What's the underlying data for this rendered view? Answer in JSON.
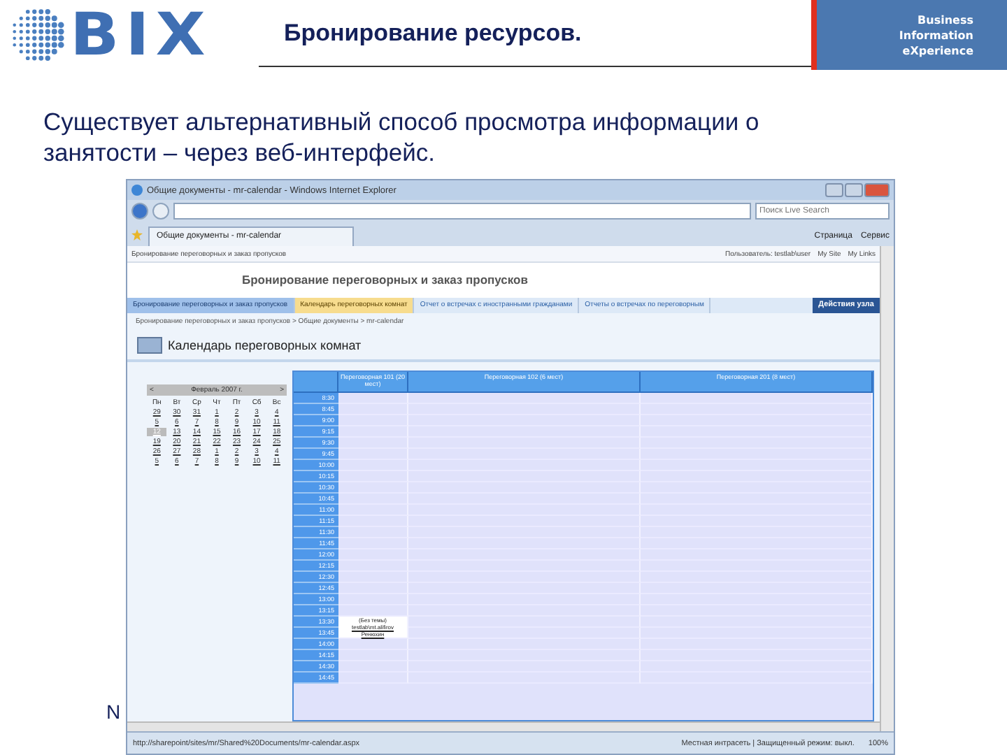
{
  "slide": {
    "logo": "BIX",
    "title": "Бронирование ресурсов.",
    "tagline": [
      "Business",
      "Information",
      "eXperience"
    ],
    "text": "Существует альтернативный способ просмотра информации о занятости – через веб-интерфейс.",
    "footer": "N"
  },
  "browser": {
    "title": "Общие документы - mr-calendar - Windows Internet Explorer",
    "search_placeholder": "Поиск Live Search",
    "tab": "Общие документы - mr-calendar",
    "toolbar": [
      "Страница",
      "Сервис"
    ],
    "status_url": "http://sharepoint/sites/mr/Shared%20Documents/mr-calendar.aspx",
    "status_zone": "Местная интрасеть | Защищенный режим: выкл.",
    "zoom": "100%"
  },
  "site": {
    "top_link": "Бронирование переговорных и заказ пропусков",
    "user": "Пользователь: testlab\\user",
    "links": [
      "My Site",
      "My Links"
    ],
    "title": "Бронирование переговорных и заказ пропусков",
    "nav": [
      {
        "label": "Бронирование переговорных и заказ пропусков",
        "selected": false
      },
      {
        "label": "Календарь переговорных комнат",
        "selected": true
      },
      {
        "label": "Отчет о встречах с иностранными гражданами",
        "selected": false
      },
      {
        "label": "Отчеты о встречах по переговорным",
        "selected": false
      }
    ],
    "actions": "Действия узла",
    "breadcrumb": "Бронирование переговорных и заказ пропусков > Общие документы > mr-calendar",
    "page_title": "Календарь переговорных комнат"
  },
  "calendar": {
    "month": "Февраль 2007 г.",
    "prev": "<",
    "next": ">",
    "weekdays": [
      "Пн",
      "Вт",
      "Ср",
      "Чт",
      "Пт",
      "Сб",
      "Вс"
    ],
    "weeks": [
      [
        {
          "day": "29",
          "selected": false
        },
        {
          "day": "30",
          "selected": false
        },
        {
          "day": "31",
          "selected": false
        },
        {
          "day": "1",
          "selected": false
        },
        {
          "day": "2",
          "selected": false
        },
        {
          "day": "3",
          "selected": false
        },
        {
          "day": "4",
          "selected": false
        }
      ],
      [
        {
          "day": "5",
          "selected": false
        },
        {
          "day": "6",
          "selected": false
        },
        {
          "day": "7",
          "selected": false
        },
        {
          "day": "8",
          "selected": false
        },
        {
          "day": "9",
          "selected": false
        },
        {
          "day": "10",
          "selected": false
        },
        {
          "day": "11",
          "selected": false
        }
      ],
      [
        {
          "day": "12",
          "selected": true
        },
        {
          "day": "13",
          "selected": false
        },
        {
          "day": "14",
          "selected": false
        },
        {
          "day": "15",
          "selected": false
        },
        {
          "day": "16",
          "selected": false
        },
        {
          "day": "17",
          "selected": false
        },
        {
          "day": "18",
          "selected": false
        }
      ],
      [
        {
          "day": "19",
          "selected": false
        },
        {
          "day": "20",
          "selected": false
        },
        {
          "day": "21",
          "selected": false
        },
        {
          "day": "22",
          "selected": false
        },
        {
          "day": "23",
          "selected": false
        },
        {
          "day": "24",
          "selected": false
        },
        {
          "day": "25",
          "selected": false
        }
      ],
      [
        {
          "day": "26",
          "selected": false
        },
        {
          "day": "27",
          "selected": false
        },
        {
          "day": "28",
          "selected": false
        },
        {
          "day": "1",
          "selected": false
        },
        {
          "day": "2",
          "selected": false
        },
        {
          "day": "3",
          "selected": false
        },
        {
          "day": "4",
          "selected": false
        }
      ],
      [
        {
          "day": "5",
          "selected": false
        },
        {
          "day": "6",
          "selected": false
        },
        {
          "day": "7",
          "selected": false
        },
        {
          "day": "8",
          "selected": false
        },
        {
          "day": "9",
          "selected": false
        },
        {
          "day": "10",
          "selected": false
        },
        {
          "day": "11",
          "selected": false
        }
      ]
    ]
  },
  "schedule": {
    "columns": [
      "Переговорная 101 (20 мест)",
      "Переговорная 102 (6 мест)",
      "Переговорная 201 (8 мест)"
    ],
    "times": [
      {
        "time": "8:30"
      },
      {
        "time": "8:45"
      },
      {
        "time": "9:00"
      },
      {
        "time": "9:15"
      },
      {
        "time": "9:30"
      },
      {
        "time": "9:45"
      },
      {
        "time": "10:00"
      },
      {
        "time": "10:15"
      },
      {
        "time": "10:30"
      },
      {
        "time": "10:45"
      },
      {
        "time": "11:00"
      },
      {
        "time": "11:15"
      },
      {
        "time": "11:30"
      },
      {
        "time": "11:45"
      },
      {
        "time": "12:00"
      },
      {
        "time": "12:15"
      },
      {
        "time": "12:30"
      },
      {
        "time": "12:45"
      },
      {
        "time": "13:00"
      },
      {
        "time": "13:15"
      },
      {
        "time": "13:30",
        "event": [
          "(Без темы)",
          "testlab\\mt.alifirov",
          "Ренюхин"
        ]
      },
      {
        "time": "13:45"
      },
      {
        "time": "14:00"
      },
      {
        "time": "14:15"
      },
      {
        "time": "14:30"
      },
      {
        "time": "14:45"
      }
    ]
  }
}
